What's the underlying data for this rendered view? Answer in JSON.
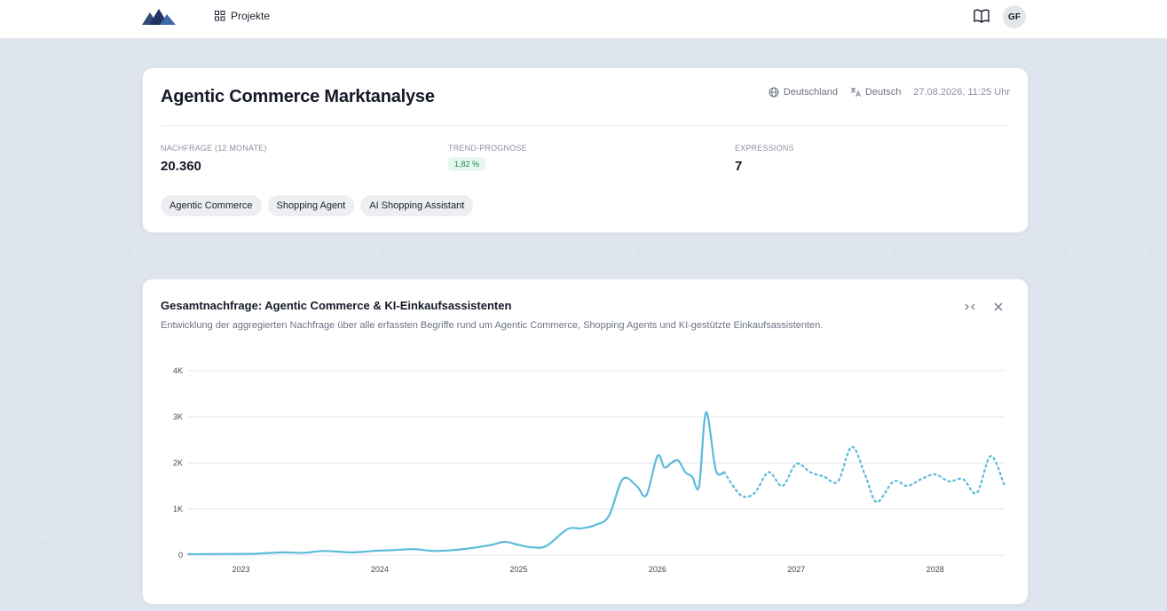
{
  "topbar": {
    "nav_projects": "Projekte",
    "avatar_initials": "GF",
    "logo_icon": "mountain-logo",
    "book_icon": "book-icon"
  },
  "project": {
    "title": "Agentic Commerce Marktanalyse",
    "country": "Deutschland",
    "language": "Deutsch",
    "date": "27.08.2026, 11:25 Uhr"
  },
  "stats": {
    "demand_label": "NACHFRAGE (12 MONATE)",
    "demand_value": "20.360",
    "trend_label": "TREND-PROGNOSE",
    "trend_value": "1,82 %",
    "expressions_label": "EXPRESSIONS",
    "expressions_value": "7"
  },
  "tags": [
    "Agentic Commerce",
    "Shopping Agent",
    "AI Shopping Assistant"
  ],
  "chart_panel": {
    "title": "Gesamtnachfrage: Agentic Commerce & KI-Einkaufsassistenten",
    "subtitle": "Entwicklung der aggregierten Nachfrage über alle erfassten Begriffe rund um Agentic Commerce, Shopping Agents und KI-gestützte Einkaufsassistenten."
  },
  "colors": {
    "line": "#5bbbd9",
    "accent_green": "#1a8a4b",
    "grid": "#e3e6eb"
  },
  "chart_data": {
    "type": "line",
    "title": "Gesamtnachfrage: Agentic Commerce & KI-Einkaufsassistenten",
    "xlabel": "",
    "ylabel": "",
    "x_range": [
      2022.62,
      2028.5
    ],
    "ylim": [
      0,
      4000
    ],
    "y_ticks": [
      0,
      1000,
      2000,
      3000,
      4000
    ],
    "y_tick_labels": [
      "0",
      "1K",
      "2K",
      "3K",
      "4K"
    ],
    "x_ticks": [
      2023,
      2024,
      2025,
      2026,
      2027,
      2028
    ],
    "x_tick_labels": [
      "2023",
      "2024",
      "2025",
      "2026",
      "2027",
      "2028"
    ],
    "grid": true,
    "series": [
      {
        "style": "solid",
        "x": [
          2022.62,
          2022.9,
          2023.1,
          2023.3,
          2023.45,
          2023.6,
          2023.8,
          2023.95,
          2024.1,
          2024.25,
          2024.4,
          2024.6,
          2024.8,
          2024.9,
          2025.0,
          2025.1,
          2025.2,
          2025.35,
          2025.45,
          2025.55,
          2025.65,
          2025.75,
          2025.85,
          2025.92,
          2026.0,
          2026.05,
          2026.1,
          2026.15,
          2026.2,
          2026.25,
          2026.3,
          2026.35,
          2026.42,
          2026.48
        ],
        "y": [
          20,
          25,
          30,
          60,
          50,
          90,
          60,
          90,
          110,
          130,
          90,
          130,
          220,
          290,
          220,
          170,
          200,
          560,
          580,
          650,
          850,
          1650,
          1500,
          1300,
          2150,
          1900,
          2000,
          2050,
          1800,
          1700,
          1500,
          3100,
          1850,
          1800
        ]
      },
      {
        "style": "dotted",
        "x": [
          2026.48,
          2026.6,
          2026.7,
          2026.8,
          2026.9,
          2027.0,
          2027.1,
          2027.2,
          2027.3,
          2027.4,
          2027.5,
          2027.58,
          2027.7,
          2027.8,
          2027.9,
          2028.0,
          2028.1,
          2028.2,
          2028.3,
          2028.4,
          2028.5
        ],
        "y": [
          1800,
          1300,
          1350,
          1800,
          1500,
          1980,
          1800,
          1700,
          1600,
          2350,
          1700,
          1150,
          1600,
          1500,
          1650,
          1750,
          1600,
          1650,
          1350,
          2150,
          1500
        ]
      }
    ]
  }
}
